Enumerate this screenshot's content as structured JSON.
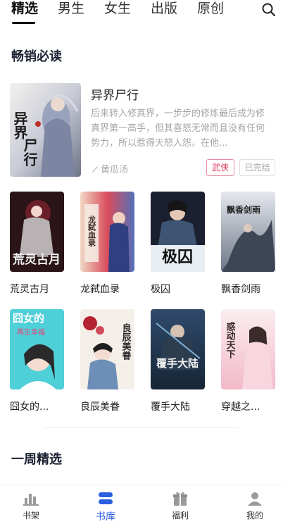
{
  "tabs": [
    {
      "label": "精选",
      "active": true
    },
    {
      "label": "男生",
      "active": false
    },
    {
      "label": "女生",
      "active": false
    },
    {
      "label": "出版",
      "active": false
    },
    {
      "label": "原创",
      "active": false
    }
  ],
  "search_icon": "search-icon",
  "sections": {
    "bestseller": "畅销必读",
    "weekly": "一周精选"
  },
  "featured": {
    "title": "异界尸行",
    "description": "后来转入修真界，一步步的修炼最后成为修真界第一高手，但其喜怒无常而且没有任何势力，所以惹得天怒人怨。在他...",
    "author": "黄瓜汤",
    "genre_tag": "武侠",
    "status_tag": "已完结",
    "cover_text": "异界尸行"
  },
  "books_row1": [
    {
      "title": "荒灵古月",
      "cover_text": "荒灵古月"
    },
    {
      "title": "龙弑血录",
      "cover_text": "龙弑血录"
    },
    {
      "title": "极囚",
      "cover_text": "极囚"
    },
    {
      "title": "飘香剑雨",
      "cover_text": "飘香剑雨"
    }
  ],
  "books_row2": [
    {
      "title": "囧女的...",
      "cover_text": "囧女的幸福"
    },
    {
      "title": "良辰美眷",
      "cover_text": "良辰美眷"
    },
    {
      "title": "覆手大陆",
      "cover_text": "覆手大陆"
    },
    {
      "title": "穿越之...",
      "cover_text": "惑动天下"
    }
  ],
  "bottom_nav": [
    {
      "label": "书架",
      "icon": "bookshelf-icon",
      "active": false
    },
    {
      "label": "书库",
      "icon": "library-icon",
      "active": true
    },
    {
      "label": "福利",
      "icon": "gift-icon",
      "active": false
    },
    {
      "label": "我的",
      "icon": "user-icon",
      "active": false
    }
  ],
  "colors": {
    "accent": "#2b5fe0",
    "genre_tag": "#d9365a",
    "muted_text": "#a6a6a6"
  }
}
